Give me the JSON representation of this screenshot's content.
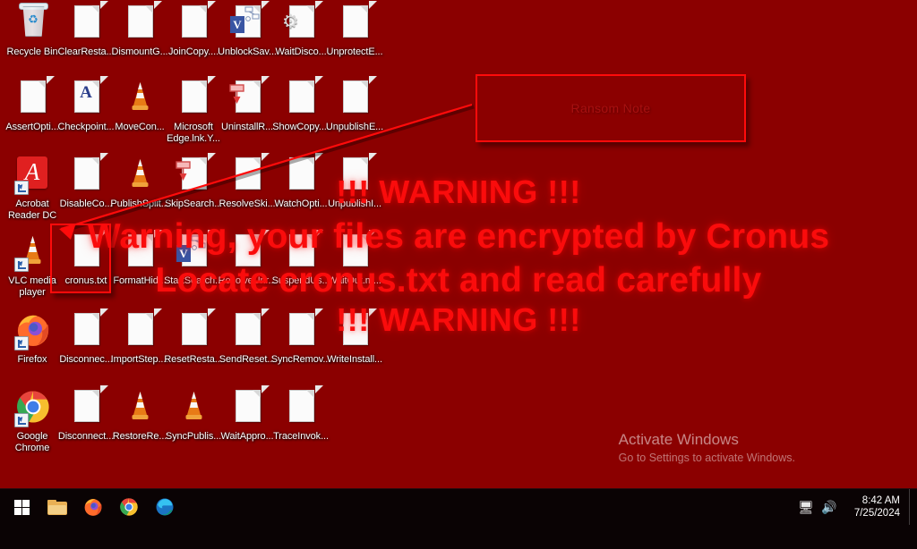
{
  "desktop": {
    "background_color": "#8B0000",
    "icons": [
      {
        "label": "Recycle Bin",
        "art": "recycle-bin-icon",
        "col": 0,
        "row": 0
      },
      {
        "label": "ClearResta...",
        "art": "text-file-icon",
        "col": 1,
        "row": 0
      },
      {
        "label": "DismountG...",
        "art": "text-file-icon",
        "col": 2,
        "row": 0
      },
      {
        "label": "JoinCopy....",
        "art": "text-file-icon",
        "col": 3,
        "row": 0
      },
      {
        "label": "UnblockSav...",
        "art": "visio-file-icon",
        "col": 4,
        "row": 0
      },
      {
        "label": "WaitDisco...",
        "art": "gear-file-icon",
        "col": 5,
        "row": 0
      },
      {
        "label": "UnprotectE...",
        "art": "text-file-icon",
        "col": 6,
        "row": 0
      },
      {
        "label": "AssertOpti...",
        "art": "text-file-icon",
        "col": 0,
        "row": 1
      },
      {
        "label": "Checkpoint...",
        "art": "font-file-icon",
        "col": 1,
        "row": 1
      },
      {
        "label": "MoveCon...",
        "art": "vlc-cone-icon",
        "col": 2,
        "row": 1
      },
      {
        "label": "Microsoft Edge.lnk.Y...",
        "art": "text-file-icon",
        "col": 3,
        "row": 1
      },
      {
        "label": "UninstallR...",
        "art": "stamp-file-icon",
        "col": 4,
        "row": 1
      },
      {
        "label": "ShowCopy....",
        "art": "text-file-icon",
        "col": 5,
        "row": 1
      },
      {
        "label": "UnpublishE...",
        "art": "text-file-icon",
        "col": 6,
        "row": 1
      },
      {
        "label": "Acrobat Reader DC",
        "art": "acrobat-icon",
        "col": 0,
        "row": 2,
        "shortcut": true
      },
      {
        "label": "DisableCo...",
        "art": "text-file-icon",
        "col": 1,
        "row": 2
      },
      {
        "label": "PublishSplit...",
        "art": "vlc-cone-icon",
        "col": 2,
        "row": 2
      },
      {
        "label": "SkipSearch...",
        "art": "stamp-file-icon",
        "col": 3,
        "row": 2
      },
      {
        "label": "ResolveSki...",
        "art": "text-file-icon",
        "col": 4,
        "row": 2
      },
      {
        "label": "WatchOpti...",
        "art": "text-file-icon",
        "col": 5,
        "row": 2
      },
      {
        "label": "UnpublishI...",
        "art": "text-file-icon",
        "col": 6,
        "row": 2
      },
      {
        "label": "VLC media player",
        "art": "vlc-cone-icon",
        "col": 0,
        "row": 3,
        "shortcut": true
      },
      {
        "label": "cronus.txt",
        "art": "text-file-icon",
        "col": 1,
        "row": 3
      },
      {
        "label": "FormatHid...",
        "art": "text-file-icon",
        "col": 2,
        "row": 3
      },
      {
        "label": "StartSearch...",
        "art": "visio-file-icon",
        "col": 3,
        "row": 3
      },
      {
        "label": "ResolveUnr...",
        "art": "text-file-icon",
        "col": 4,
        "row": 3
      },
      {
        "label": "SuspendUs...",
        "art": "text-file-icon",
        "col": 5,
        "row": 3
      },
      {
        "label": "WaitOut.m...",
        "art": "text-file-icon",
        "col": 6,
        "row": 3
      },
      {
        "label": "Firefox",
        "art": "firefox-icon",
        "col": 0,
        "row": 4,
        "shortcut": true
      },
      {
        "label": "Disconnec...",
        "art": "text-file-icon",
        "col": 1,
        "row": 4
      },
      {
        "label": "ImportStep....",
        "art": "text-file-icon",
        "col": 2,
        "row": 4
      },
      {
        "label": "ResetResta...",
        "art": "text-file-icon",
        "col": 3,
        "row": 4
      },
      {
        "label": "SendReset...",
        "art": "text-file-icon",
        "col": 4,
        "row": 4
      },
      {
        "label": "SyncRemov...",
        "art": "text-file-icon",
        "col": 5,
        "row": 4
      },
      {
        "label": "WriteInstall...",
        "art": "text-file-icon",
        "col": 6,
        "row": 4
      },
      {
        "label": "Google Chrome",
        "art": "chrome-icon",
        "col": 0,
        "row": 5,
        "shortcut": true
      },
      {
        "label": "Disconnect...",
        "art": "text-file-icon",
        "col": 1,
        "row": 5
      },
      {
        "label": "RestoreRe...",
        "art": "vlc-cone-icon",
        "col": 2,
        "row": 5
      },
      {
        "label": "SyncPublis...",
        "art": "vlc-cone-icon",
        "col": 3,
        "row": 5
      },
      {
        "label": "WaitAppro...",
        "art": "text-file-icon",
        "col": 4,
        "row": 5
      },
      {
        "label": "TraceInvok...",
        "art": "text-file-icon",
        "col": 5,
        "row": 5
      }
    ]
  },
  "ransom_overlay": {
    "color": "#fa0c0c",
    "line_top": "!!! WARNING !!!",
    "line_mid_1": "Warning, your files are encrypted by Cronus",
    "line_mid_2": "Locate cronus.txt and read carefully",
    "line_bottom": "!!! WARNING !!!"
  },
  "annotations": {
    "accent_color": "#ff0b0b",
    "ransom_note_label": "Ransom Note",
    "highlighted_file": "cronus.txt"
  },
  "watermark": {
    "title": "Activate Windows",
    "subtitle": "Go to Settings to activate Windows."
  },
  "taskbar": {
    "background_color": "#0a0304",
    "items": [
      {
        "name": "start-button",
        "icon": "windows-logo-icon"
      },
      {
        "name": "file-explorer-button",
        "icon": "folder-icon"
      },
      {
        "name": "firefox-taskbar-button",
        "icon": "firefox-icon"
      },
      {
        "name": "chrome-taskbar-button",
        "icon": "chrome-icon"
      },
      {
        "name": "edge-taskbar-button",
        "icon": "edge-icon"
      }
    ],
    "tray": {
      "network_icon": "network-icon",
      "volume_icon": "volume-icon",
      "time": "8:42 AM",
      "date": "7/25/2024"
    }
  }
}
